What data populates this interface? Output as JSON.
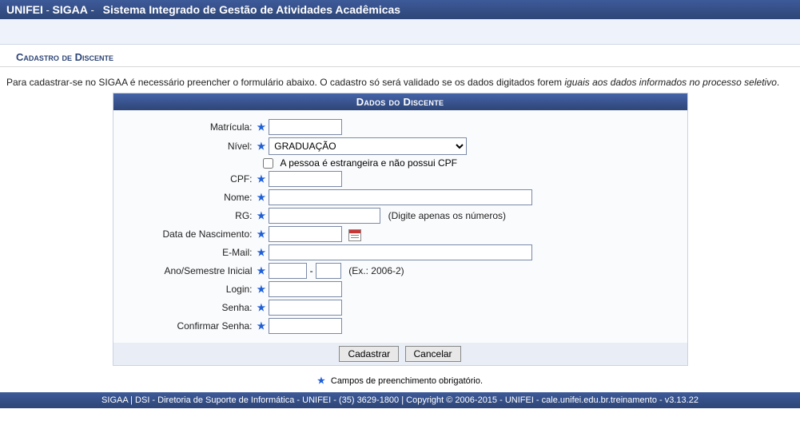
{
  "header": {
    "org": "UNIFEI",
    "sys": "SIGAA",
    "sep": "-",
    "full": "Sistema Integrado de Gestão de Atividades Acadêmicas"
  },
  "section_title": "Cadastro de Discente",
  "intro": {
    "pre": "Para cadastrar-se no SIGAA é necessário preencher o formulário abaixo. O cadastro só será validado se os dados digitados forem ",
    "em": "iguais aos dados informados no processo seletivo",
    "post": "."
  },
  "form": {
    "title": "Dados do Discente",
    "labels": {
      "matricula": "Matrícula:",
      "nivel": "Nível:",
      "estrangeiro": "A pessoa é estrangeira e não possui CPF",
      "cpf": "CPF:",
      "nome": "Nome:",
      "rg": "RG:",
      "rg_hint": "(Digite apenas os números)",
      "nasc": "Data de Nascimento:",
      "email": "E-Mail:",
      "anosem": "Ano/Semestre Inicial",
      "anosem_hint": "(Ex.: 2006-2)",
      "anosem_sep": "-",
      "login": "Login:",
      "senha": "Senha:",
      "csenha": "Confirmar Senha:"
    },
    "values": {
      "matricula": "",
      "nivel": "GRADUAÇÃO",
      "estrangeiro": false,
      "cpf": "",
      "nome": "",
      "rg": "",
      "nasc": "",
      "email": "",
      "ano": "",
      "sem": "",
      "login": "",
      "senha": "",
      "csenha": ""
    },
    "buttons": {
      "submit": "Cadastrar",
      "cancel": "Cancelar"
    },
    "required_note": "Campos de preenchimento obrigatório."
  },
  "footer": "SIGAA | DSI - Diretoria de Suporte de Informática - UNIFEI - (35) 3629-1800 | Copyright © 2006-2015 - UNIFEI - cale.unifei.edu.br.treinamento - v3.13.22"
}
